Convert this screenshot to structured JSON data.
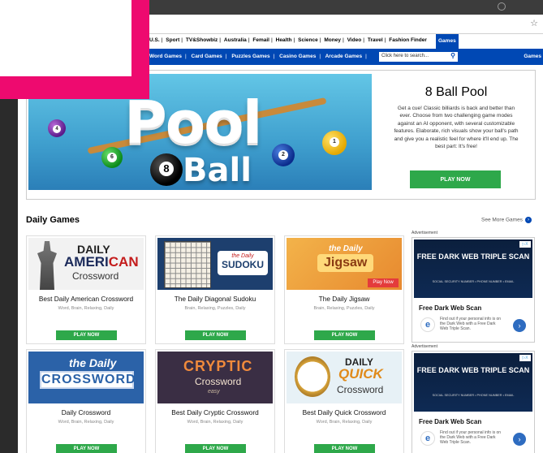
{
  "browser": {
    "bookmark_icon": "star-icon",
    "window_control_icon": "circle-icon"
  },
  "topnav": {
    "items": [
      "U.S.",
      "Sport",
      "TV&Showbiz",
      "Australia",
      "Femail",
      "Health",
      "Science",
      "Money",
      "Video",
      "Travel",
      "Fashion Finder"
    ],
    "active_tab": "Games"
  },
  "subnav": {
    "items": [
      "Word Games",
      "Card Games",
      "Puzzles Games",
      "Casino Games",
      "Arcade Games"
    ],
    "search_placeholder": "Click here to search...",
    "right_label": "Games"
  },
  "hero": {
    "image_title_top": "Pool",
    "image_title_bottom": "Ball",
    "title": "8 Ball Pool",
    "description": "Get a cue! Classic billiards is back and better than ever. Choose from two challenging game modes against an AI opponent, with several customizable features. Elaborate, rich visuals show your ball's path and give you a realistic feel for where it'll end up. The best part: It's free!",
    "button": "PLAY NOW",
    "balls": [
      "8",
      "1",
      "2",
      "6",
      "4"
    ]
  },
  "daily": {
    "title": "Daily Games",
    "see_more": "See More Games",
    "games": [
      {
        "title": "Best Daily American Crossword",
        "tags": "Word, Brain, Relaxing, Daily",
        "button": "PLAY NOW",
        "thumb": {
          "l1": "DAILY",
          "l2a": "AMERI",
          "l2b": "CAN",
          "l3": "Crossword"
        }
      },
      {
        "title": "The Daily Diagonal Sudoku",
        "tags": "Brain, Relaxing, Puzzles, Daily",
        "button": "PLAY NOW",
        "thumb": {
          "l1": "the Daily",
          "l2": "SUDOKU"
        }
      },
      {
        "title": "The Daily Jigsaw",
        "tags": "Brain, Relaxing, Puzzles, Daily",
        "button": "PLAY NOW",
        "thumb": {
          "l1": "the Daily",
          "l2": "Jigsaw",
          "l3": "Play Now"
        }
      },
      {
        "title": "Daily Crossword",
        "tags": "Word, Brain, Relaxing, Daily",
        "button": "PLAY NOW",
        "thumb": {
          "l1": "the Daily",
          "l2": "CROSSWORD"
        }
      },
      {
        "title": "Best Daily Cryptic Crossword",
        "tags": "Word, Brain, Relaxing, Daily",
        "button": "PLAY NOW",
        "thumb": {
          "l1": "CRYPTIC",
          "l2": "Crossword",
          "l3": "easy"
        }
      },
      {
        "title": "Best Daily Quick Crossword",
        "tags": "Word, Brain, Relaxing, Daily",
        "button": "PLAY NOW",
        "thumb": {
          "l1": "DAILY",
          "l2": "QUICK",
          "l3": "Crossword"
        }
      }
    ]
  },
  "ads": [
    {
      "label": "Advertisement",
      "headline_banner": "FREE DARK WEB TRIPLE SCAN",
      "sub_banner": "SOCIAL SECURITY NUMBER • PHONE NUMBER • EMAIL",
      "headline": "Free Dark Web Scan",
      "copy": "Find out if your personal info is on the Dark Web with a Free Dark Web Triple Scan.",
      "logo": "e",
      "choices": "▷X"
    },
    {
      "label": "Advertisement",
      "headline_banner": "FREE DARK WEB TRIPLE SCAN",
      "sub_banner": "SOCIAL SECURITY NUMBER • PHONE NUMBER • EMAIL",
      "headline": "Free Dark Web Scan",
      "copy": "Find out if your personal info is on the Dark Web with a Free Dark Web Triple Scan.",
      "logo": "e",
      "choices": "▷X"
    }
  ],
  "colors": {
    "brand_blue": "#0048b4",
    "play_green": "#2ea84a",
    "overlay_pink": "#ee0a6f"
  }
}
